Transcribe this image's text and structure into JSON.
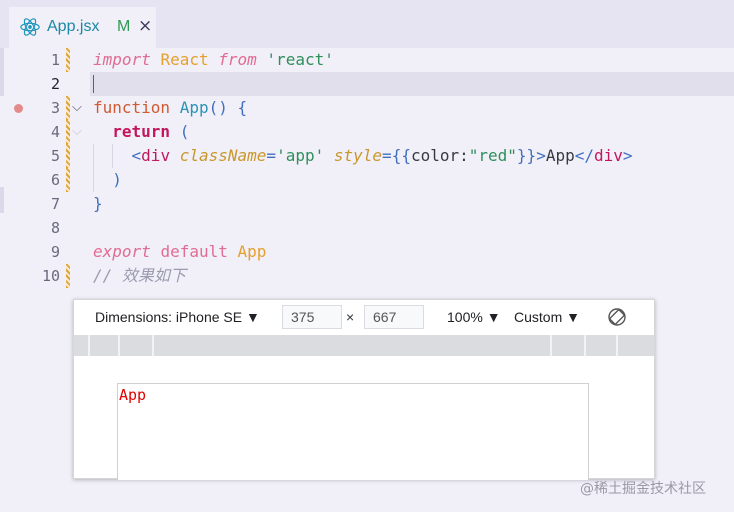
{
  "tab": {
    "icon": "react-icon",
    "title": "App.jsx",
    "status": "M",
    "close": "×"
  },
  "editor": {
    "line_numbers": [
      "1",
      "2",
      "3",
      "4",
      "5",
      "6",
      "7",
      "8",
      "9",
      "10"
    ],
    "active_line": 2,
    "code": {
      "l1_import": "import",
      "l1_react": "React",
      "l1_from": "from",
      "l1_str": "'react'",
      "l3_function": "function",
      "l3_name": "App",
      "l3_rest": "() {",
      "l4_return": "return",
      "l4_paren": "(",
      "l5_open": "<",
      "l5_tag": "div",
      "l5_attr1": "className",
      "l5_eq1": "=",
      "l5_val1": "'app'",
      "l5_attr2": "style",
      "l5_eq2": "=",
      "l5_brace_open": "{{",
      "l5_prop": "color:",
      "l5_val2": "\"red\"",
      "l5_brace_close": "}}",
      "l5_gt": ">",
      "l5_text": "App",
      "l5_close_lt": "</",
      "l5_close_tag": "div",
      "l5_close_gt": ">",
      "l6_paren": ")",
      "l7_brace": "}",
      "l9_export": "export",
      "l9_default": "default",
      "l9_app": "App",
      "l10_comment": "// 效果如下"
    },
    "colors": {
      "keyword": "#e06c93",
      "string": "#2e8f5c",
      "function": "#d05a32",
      "modified_gutter": "#e0a53a"
    }
  },
  "preview": {
    "dimensions_label": "Dimensions: iPhone SE ▼",
    "width_value": "375",
    "height_value": "667",
    "times": "×",
    "zoom_label": "100% ▼",
    "throttle_label": "Custom ▼",
    "rotate_icon": "rotate-icon",
    "viewport_text": "App",
    "viewport_text_color": "#e00000"
  },
  "watermark": "@稀土掘金技术社区"
}
